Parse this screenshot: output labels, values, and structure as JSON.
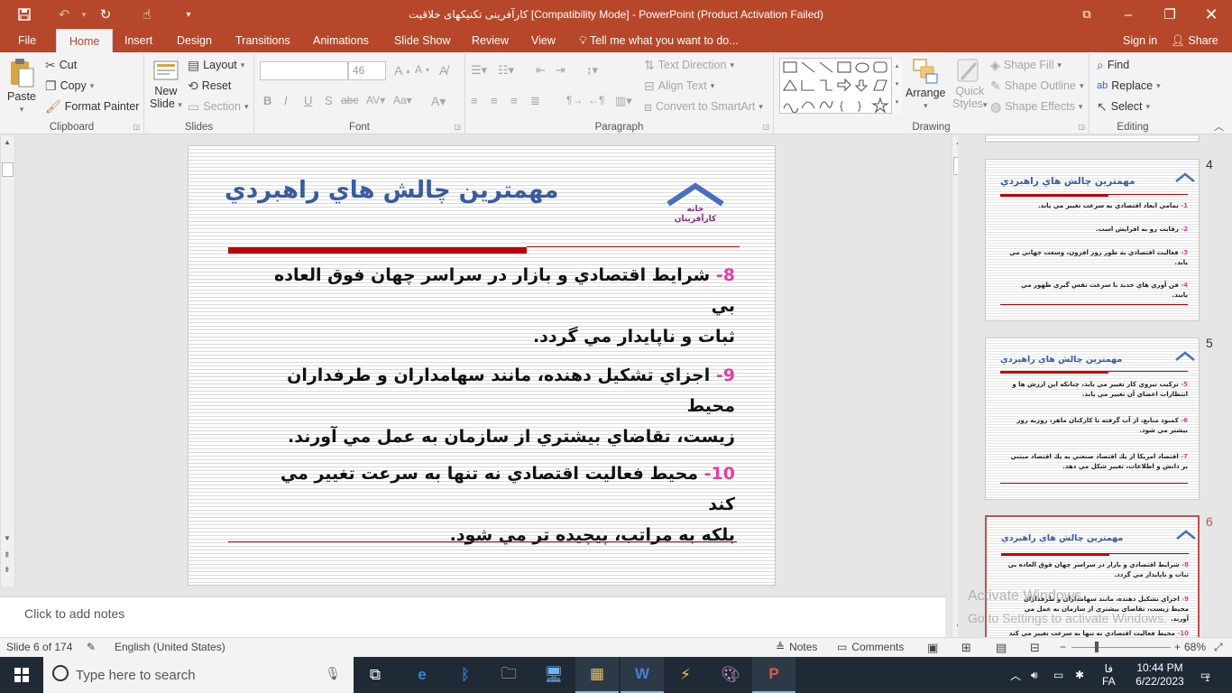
{
  "window": {
    "title": "کارآفرینی تکنیکهای خلاقیت [Compatibility Mode] - PowerPoint (Product Activation Failed)",
    "icons": [
      "save-icon",
      "undo-icon",
      "redo-icon",
      "touch-mode-icon",
      "customize-icon",
      "ribbon-display-icon",
      "minimize-icon",
      "restore-icon",
      "close-icon"
    ]
  },
  "tabs": [
    "File",
    "Home",
    "Insert",
    "Design",
    "Transitions",
    "Animations",
    "Slide Show",
    "Review",
    "View"
  ],
  "active_tab": "Home",
  "tell_me": "Tell me what you want to do...",
  "sign_in": "Sign in",
  "share": "Share",
  "ribbon": {
    "clipboard": {
      "label": "Clipboard",
      "paste": "Paste",
      "cut": "Cut",
      "copy": "Copy",
      "format_painter": "Format Painter"
    },
    "slides": {
      "label": "Slides",
      "new_slide_1": "New",
      "new_slide_2": "Slide",
      "layout": "Layout",
      "reset": "Reset",
      "section": "Section"
    },
    "font": {
      "label": "Font",
      "font_name": "",
      "font_size": "46"
    },
    "paragraph": {
      "label": "Paragraph",
      "text_direction": "Text Direction",
      "align_text": "Align Text",
      "smartart": "Convert to SmartArt"
    },
    "drawing": {
      "label": "Drawing",
      "arrange": "Arrange",
      "quick_1": "Quick",
      "quick_2": "Styles",
      "shape_fill": "Shape Fill",
      "shape_outline": "Shape Outline",
      "shape_effects": "Shape Effects"
    },
    "editing": {
      "label": "Editing",
      "find": "Find",
      "replace": "Replace",
      "select": "Select"
    }
  },
  "slide": {
    "title": "مهمترين چالش هاي راهبردي",
    "logo_text": "خانه کارآفرینان",
    "points": [
      {
        "num": "8-",
        "line1": "شرايط اقتصادي و بازار در سراسر چهان فوق العاده بي",
        "line2": "ثبات و ناپايدار مي گردد."
      },
      {
        "num": "9-",
        "line1": "اجزاي تشكيل دهنده، مانند سهامداران و طرفداران محيط",
        "line2": "زيست، تقاضاي بيشتري از سازمان به عمل مي آورند."
      },
      {
        "num": "10-",
        "line1": "محيط فعاليت اقتصادي نه تنها به سرعت تغيير مي كند",
        "line2": "بلكه به مراتب، پيچيده تر مي شود."
      }
    ]
  },
  "notes_placeholder": "Click to add notes",
  "thumbnails": [
    {
      "number": "4",
      "title": "مهمترين چالش هاي راهبردي",
      "items": [
        {
          "num": "1-",
          "text": "تمامي ابعاد اقتصادي به سرعت تغيير مي يابد."
        },
        {
          "num": "2-",
          "text": "رقابت رو به افزايش است."
        },
        {
          "num": "3-",
          "text": "فعاليت اقتصادي به طور روز افزون، وسعت جهاني مي يابد."
        },
        {
          "num": "4-",
          "text": "فن آوري هاي جديد با سرعت نفس گيري ظهور مي يابند."
        }
      ]
    },
    {
      "number": "5",
      "title": "مهمترين چالش هاي راهبردي",
      "items": [
        {
          "num": "5-",
          "text": "تركيب نيروي كار تغيير مي يابد، چنانكه اين ارزش ها و انتظارات اعضاي آن تغيير مي يابد."
        },
        {
          "num": "6-",
          "text": "كمبود منابع، از آب گرفته تا كاركنان ماهر، روزبه روز بيشتر مي شود."
        },
        {
          "num": "7-",
          "text": "اقتصاد امريكا از يك اقتصاد صنعتي به يك اقتصاد مبتني بر دانش و اطلاعات، تغيير شكل مي دهد."
        }
      ]
    },
    {
      "number": "6",
      "title": "مهمترين چالش هاي راهبردي",
      "items": [
        {
          "num": "8-",
          "text": "شرايط اقتصادي و بازار در سراسر چهان فوق العاده بي ثبات و ناپايدار مي گردد."
        },
        {
          "num": "9-",
          "text": "اجزاي تشكيل دهنده، مانند سهامداران و طرفداران محيط زيست، تقاضاي بيشتري از سازمان به عمل مي آورند."
        },
        {
          "num": "10-",
          "text": "محيط فعاليت اقتصادي نه تنها به سرعت تغيير مي كند"
        }
      ]
    }
  ],
  "watermark": {
    "line1": "Activate Windows",
    "line2": "Go to Settings to activate Windows."
  },
  "status": {
    "slide_info": "Slide 6 of 174",
    "language": "English (United States)",
    "notes": "Notes",
    "comments": "Comments",
    "zoom": "68%"
  },
  "taskbar": {
    "search_placeholder": "Type here to search",
    "lang": "FA",
    "lang_script": "فا",
    "time": "10:44 PM",
    "date": "6/22/2023",
    "notification_count": "1"
  }
}
